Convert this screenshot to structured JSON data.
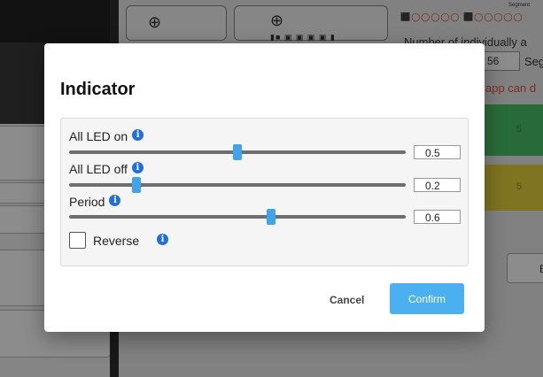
{
  "background": {
    "add_icon_a": "⊕",
    "add_icon_b": "⊕",
    "strip_glyphs": "▮■ ▣ ▣ ▣ ▣ ▮",
    "segment_strip": "⬛◯◯◯◯◯ ⬛◯◯◯◯◯",
    "segment_label": "Segment",
    "description": "Number of individually a",
    "count_value": "56",
    "count_unit": "Seg",
    "warning": "app can d",
    "band_green_num": "5",
    "band_yellow_num": "5",
    "side_button": "E"
  },
  "dialog": {
    "title": "Indicator",
    "info_glyph": "i",
    "sliders": [
      {
        "label": "All LED on",
        "value": "0.5",
        "fraction": 0.5
      },
      {
        "label": "All LED off",
        "value": "0.2",
        "fraction": 0.2
      },
      {
        "label": "Period",
        "value": "0.6",
        "fraction": 0.6
      }
    ],
    "reverse_label": "Reverse",
    "reverse_checked": false,
    "cancel_label": "Cancel",
    "confirm_label": "Confirm"
  },
  "colors": {
    "accent": "#4ab0f0",
    "info": "#1f6fe0",
    "warning": "#e2553c",
    "green_band": "#4cc467",
    "yellow_band": "#e8d33c"
  }
}
